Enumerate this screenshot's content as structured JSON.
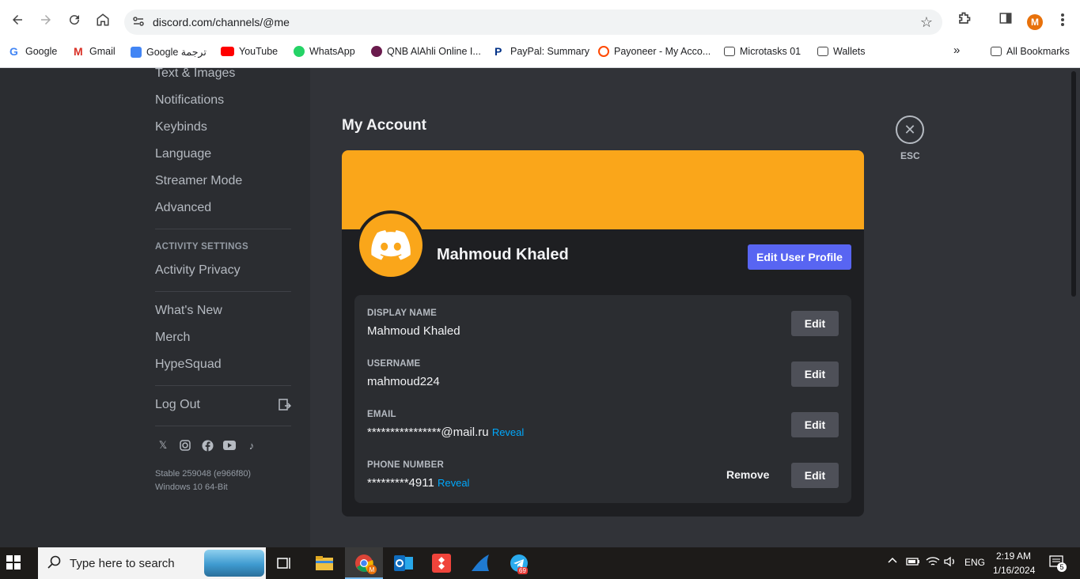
{
  "browser": {
    "url": "discord.com/channels/@me",
    "profile_initial": "M",
    "bookmarks": [
      {
        "label": "Google",
        "icon": "google-icon"
      },
      {
        "label": "Gmail",
        "icon": "gmail-icon"
      },
      {
        "label": "Google ترجمة",
        "icon": "translate-icon"
      },
      {
        "label": "YouTube",
        "icon": "youtube-icon"
      },
      {
        "label": "WhatsApp",
        "icon": "whatsapp-icon"
      },
      {
        "label": "QNB AlAhli Online I...",
        "icon": "qnb-icon"
      },
      {
        "label": "PayPal: Summary",
        "icon": "paypal-icon"
      },
      {
        "label": "Payoneer - My Acco...",
        "icon": "payoneer-icon"
      },
      {
        "label": "Microtasks 01",
        "icon": "folder-icon"
      },
      {
        "label": "Wallets",
        "icon": "folder-icon"
      }
    ],
    "more_label": "»",
    "all_bookmarks": "All Bookmarks"
  },
  "sidebar": {
    "items_top": [
      "Text & Images",
      "Notifications",
      "Keybinds",
      "Language",
      "Streamer Mode",
      "Advanced"
    ],
    "activity_header": "ACTIVITY SETTINGS",
    "activity_privacy": "Activity Privacy",
    "items_mid": [
      "What's New",
      "Merch",
      "HypeSquad"
    ],
    "logout": "Log Out",
    "version": "Stable 259048 (e966f80)",
    "os": "Windows 10 64-Bit"
  },
  "account": {
    "title": "My Account",
    "esc": "ESC",
    "name": "Mahmoud Khaled",
    "edit_profile": "Edit User Profile",
    "banner_color": "#faa61a",
    "fields": {
      "display_name": {
        "label": "DISPLAY NAME",
        "value": "Mahmoud Khaled"
      },
      "username": {
        "label": "USERNAME",
        "value": "mahmoud224"
      },
      "email": {
        "label": "EMAIL",
        "value": "****************@mail.ru",
        "reveal": "Reveal"
      },
      "phone": {
        "label": "PHONE NUMBER",
        "value": "*********4911",
        "reveal": "Reveal"
      }
    },
    "edit": "Edit",
    "remove": "Remove"
  },
  "taskbar": {
    "search_placeholder": "Type here to search",
    "chrome_badge": "M",
    "telegram_badge": "69",
    "lang": "ENG",
    "time": "2:19 AM",
    "date": "1/16/2024",
    "notifications": "5"
  }
}
